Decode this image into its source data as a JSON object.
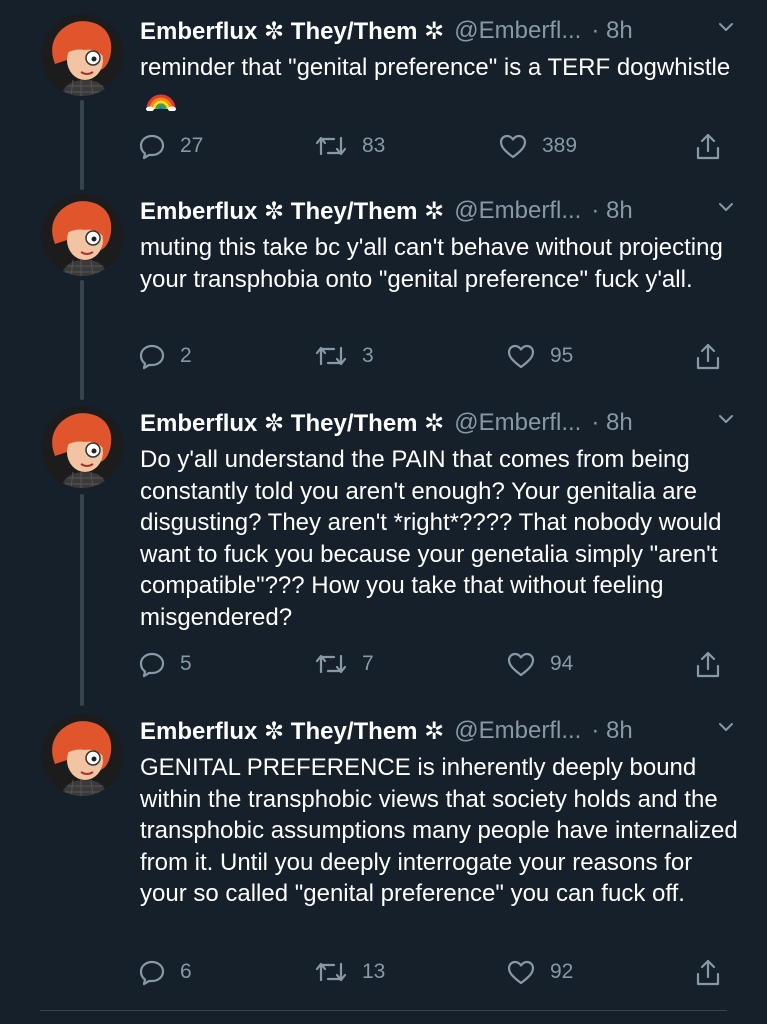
{
  "colors": {
    "background": "#15202b",
    "text_primary": "#ffffff",
    "text_secondary": "#8899a6",
    "thread_line": "#38444d"
  },
  "tweets": [
    {
      "display_name": "Emberflux ✼ They/Them ✲",
      "handle": "@Emberfl...",
      "time": "· 8h",
      "text": "reminder that \"genital preference\" is a TERF dogwhistle",
      "emoji": "rainbow-icon",
      "replies": "27",
      "retweets": "83",
      "likes": "389"
    },
    {
      "display_name": "Emberflux ✼ They/Them ✲",
      "handle": "@Emberfl...",
      "time": "· 8h",
      "text": "muting this take bc y'all can't behave without projecting your transphobia onto \"genital preference\" fuck y'all.",
      "replies": "2",
      "retweets": "3",
      "likes": "95"
    },
    {
      "display_name": "Emberflux ✼ They/Them ✲",
      "handle": "@Emberfl...",
      "time": "· 8h",
      "text": "Do y'all understand the PAIN that comes from being constantly told you aren't enough? Your genitalia are disgusting? They aren't *right*???? That nobody would want to fuck you because your genetalia simply \"aren't compatible\"??? How you take that without feeling misgendered?",
      "replies": "5",
      "retweets": "7",
      "likes": "94"
    },
    {
      "display_name": "Emberflux ✼ They/Them ✲",
      "handle": "@Emberfl...",
      "time": "· 8h",
      "text": "GENITAL PREFERENCE is inherently deeply bound within the transphobic views that society holds and the transphobic assumptions many people have internalized from it. Until you deeply interrogate your reasons for your so called \"genital preference\" you can fuck off.",
      "replies": "6",
      "retweets": "13",
      "likes": "92"
    }
  ]
}
